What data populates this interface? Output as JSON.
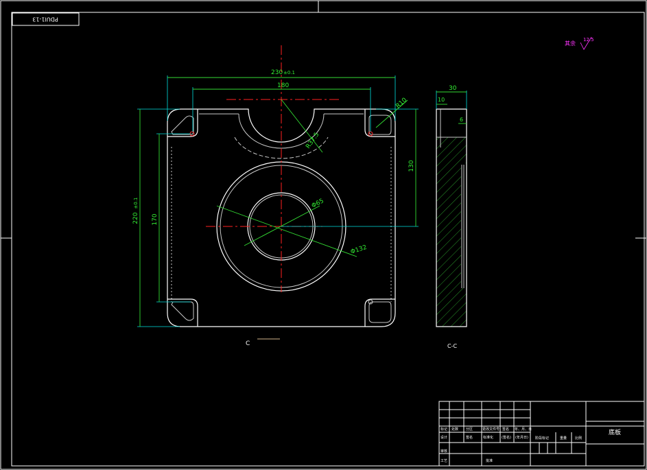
{
  "drawing": {
    "code_box": "PDUI1-13",
    "roughness_note": "其余",
    "roughness_value": "12.5",
    "section_label_front": "C",
    "section_label_side": "C-C"
  },
  "dimensions": {
    "overall_width": "230",
    "overall_width_suffix": "±0.1",
    "hole_spacing_x": "180",
    "overall_height": "220",
    "overall_height_suffix": "±0.1",
    "hole_spacing_y": "170",
    "center_offset": "130",
    "corner_radius": "R10",
    "notch_radius": "R37.5",
    "bore_diameter": "Φ65",
    "ring_diameter": "Φ132",
    "thickness": "30",
    "step_depth": "10",
    "recess_depth": "6"
  },
  "title_block": {
    "part_name": "底板",
    "headers_row1": [
      "标记",
      "处数",
      "分区",
      "更改文件号",
      "签名",
      "年、月、日"
    ],
    "headers_row2": [
      "设计",
      "签名",
      "标准化",
      "(签名)",
      "(年月日)"
    ],
    "stage_labels": [
      "阶段标记",
      "重量",
      "比例"
    ],
    "footer_labels": [
      "审核",
      "工艺",
      "批准"
    ]
  }
}
